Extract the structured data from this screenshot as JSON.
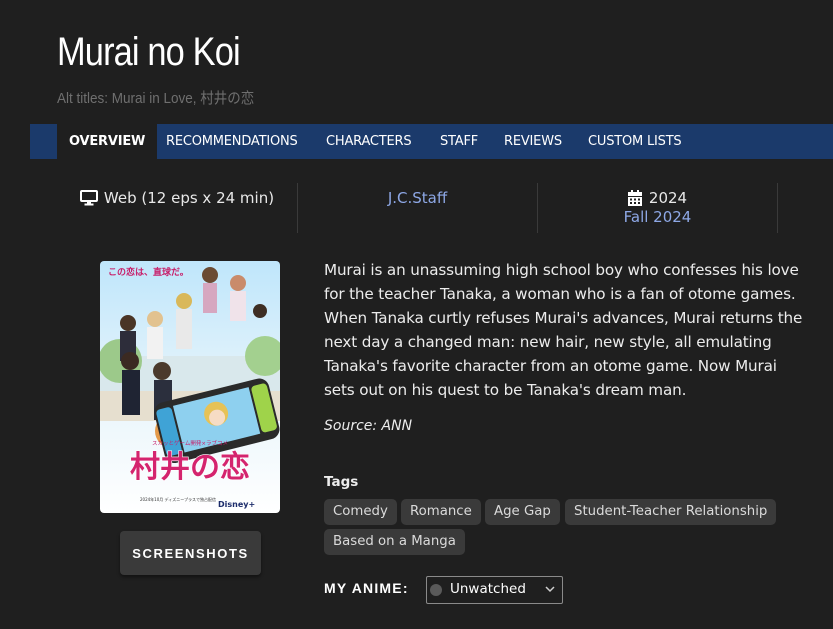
{
  "header": {
    "title": "Murai no Koi",
    "alt_titles": "Alt titles: Murai in Love, 村井の恋"
  },
  "nav": {
    "tabs": [
      {
        "label": "OVERVIEW",
        "active": true
      },
      {
        "label": "RECOMMENDATIONS",
        "active": false
      },
      {
        "label": "CHARACTERS",
        "active": false
      },
      {
        "label": "STAFF",
        "active": false
      },
      {
        "label": "REVIEWS",
        "active": false
      },
      {
        "label": "CUSTOM LISTS",
        "active": false
      }
    ]
  },
  "info": {
    "format": {
      "icon": "monitor-icon",
      "text": "Web (12 eps x 24 min)"
    },
    "studio": "J.C.Staff",
    "year": {
      "icon": "calendar-icon",
      "text": "2024"
    },
    "season": "Fall 2024"
  },
  "poster": {
    "tagline": "この恋は、直球だ。",
    "title_jp": "村井の恋",
    "subtitle": "スカッとゲーム開発×ラブコメ",
    "credits": "2024年10月 ディズニープラスで独占配信",
    "brand": "Disney+"
  },
  "screenshots_label": "SCREENSHOTS",
  "synopsis": "Murai is an unassuming high school boy who confesses his love for the teacher Tanaka, a woman who is a fan of otome games. When Tanaka curtly refuses Murai's advances, Murai returns the next day a changed man: new hair, new style, all emulating Tanaka's favorite character from an otome game. Now Murai sets out on his quest to be Tanaka's dream man.",
  "source": "Source: ANN",
  "tags": {
    "label": "Tags",
    "items": [
      "Comedy",
      "Romance",
      "Age Gap",
      "Student-Teacher Relationship",
      "Based on a Manga"
    ]
  },
  "my_anime": {
    "label": "MY ANIME:",
    "status": "Unwatched"
  },
  "colors": {
    "background": "#1f1f1f",
    "nav_bar": "#1b3a6b",
    "link": "#8ea8e6",
    "tag_bg": "#3a3a3a"
  }
}
